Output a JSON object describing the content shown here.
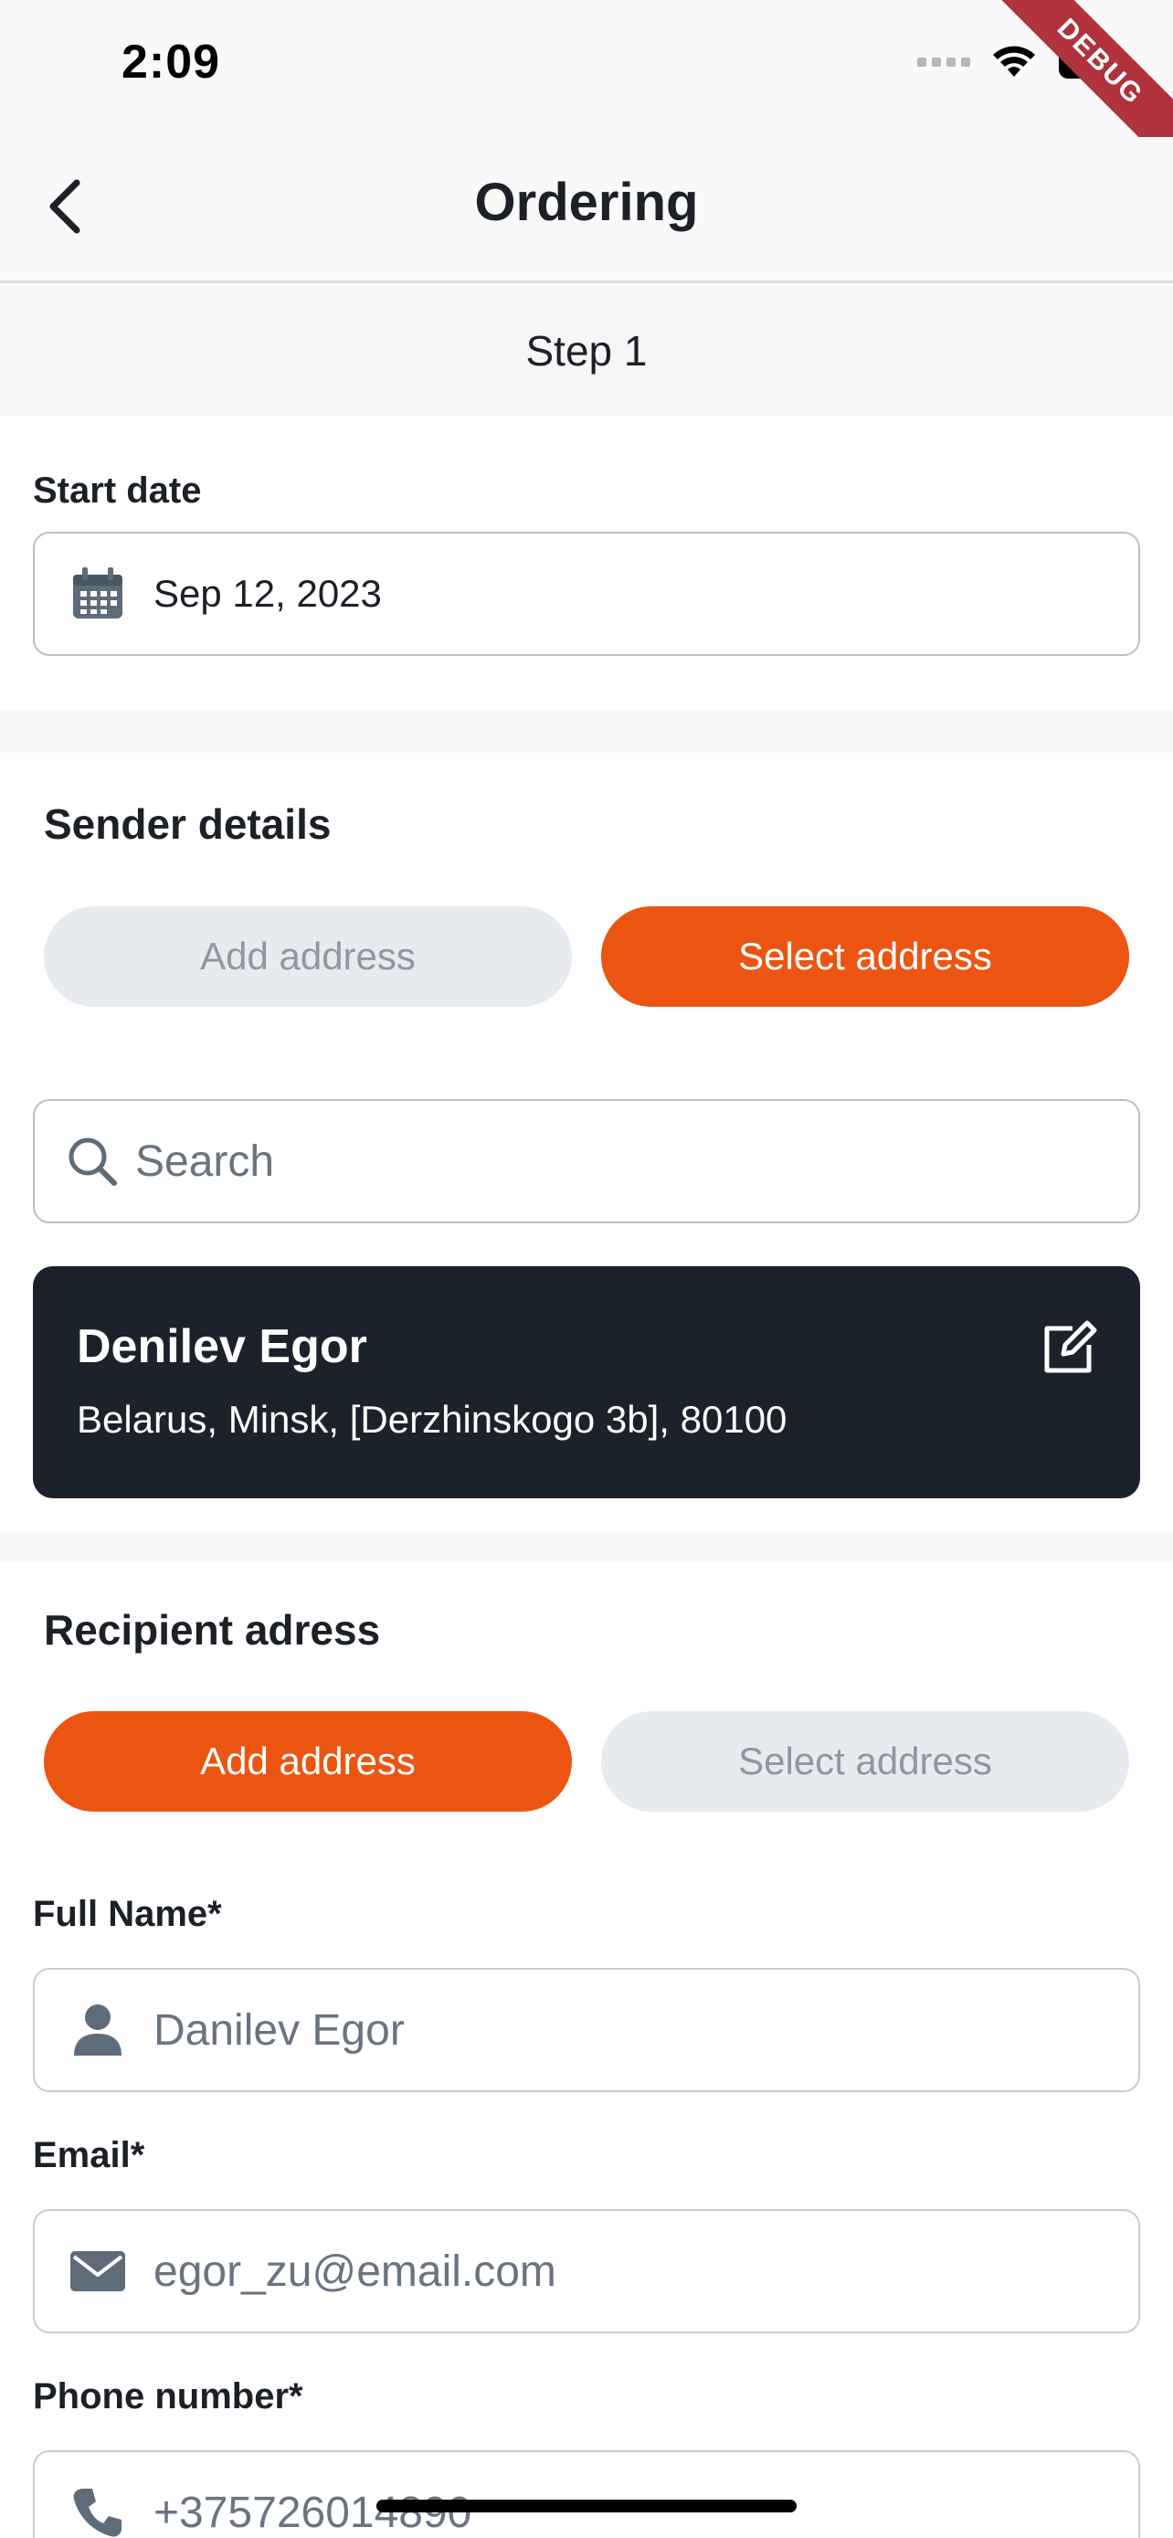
{
  "status_bar": {
    "time": "2:09",
    "debug_label": "DEBUG"
  },
  "nav": {
    "title": "Ordering",
    "back_icon": "chevron-left-icon"
  },
  "step": {
    "label": "Step 1"
  },
  "start_date": {
    "label": "Start date",
    "value": "Sep 12, 2023",
    "icon": "calendar-icon"
  },
  "sender": {
    "title": "Sender details",
    "add_address_label": "Add address",
    "select_address_label": "Select address",
    "active": "select_address",
    "search": {
      "placeholder": "Search",
      "icon": "search-icon"
    },
    "card": {
      "name": "Denilev Egor",
      "address": "Belarus, Minsk, [Derzhinskogo 3b], 80100",
      "edit_icon": "edit-icon"
    }
  },
  "recipient": {
    "title": "Recipient adress",
    "add_address_label": "Add address",
    "select_address_label": "Select address",
    "active": "add_address",
    "full_name": {
      "label": "Full Name*",
      "placeholder": "Danilev Egor",
      "icon": "person-icon"
    },
    "email": {
      "label": "Email*",
      "placeholder": "egor_zu@email.com",
      "icon": "mail-icon"
    },
    "phone": {
      "label": "Phone number*",
      "placeholder": "+375726014890",
      "icon": "phone-icon"
    }
  },
  "colors": {
    "accent": "#eb5511",
    "pill_inactive": "#e7ebef",
    "card_dark": "#1b222b",
    "field_border": "#b8bfc8"
  }
}
